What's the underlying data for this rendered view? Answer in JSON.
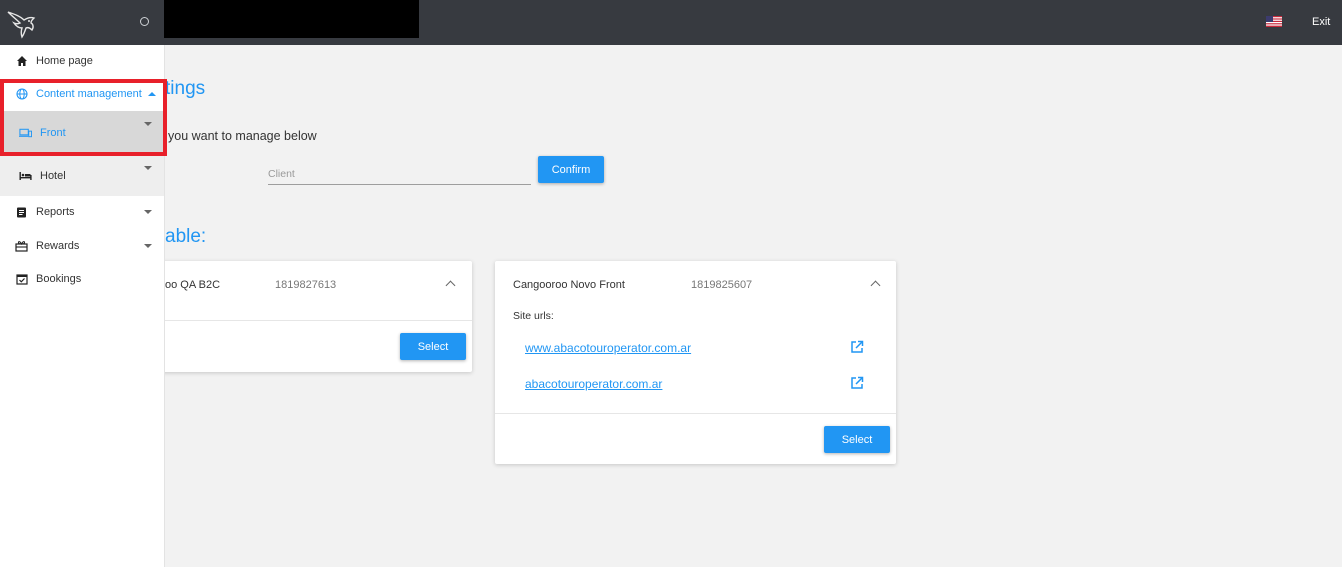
{
  "topbar": {
    "exit_label": "Exit",
    "bg_color": "#373a40",
    "flag_icon": "us-flag-icon"
  },
  "sidebar": {
    "items": [
      {
        "label": "Home page",
        "icon": "home-icon"
      },
      {
        "label": "Content management",
        "icon": "globe-icon",
        "expanded": true
      },
      {
        "label": "Front",
        "icon": "devices-icon"
      },
      {
        "label": "Hotel",
        "icon": "bed-icon"
      },
      {
        "label": "Reports",
        "icon": "clipboard-icon"
      },
      {
        "label": "Rewards",
        "icon": "gift-icon"
      },
      {
        "label": "Bookings",
        "icon": "calendar-check-icon"
      }
    ]
  },
  "main": {
    "page_title": "tings",
    "instruction": "you want to manage below",
    "client_placeholder": "Client",
    "confirm_label": "Confirm",
    "section_title": "able:"
  },
  "cards": [
    {
      "name": "oo QA B2C",
      "code": "1819827613",
      "select_label": "Select"
    },
    {
      "name": "Cangooroo Novo Front",
      "code": "1819825607",
      "site_urls_label": "Site urls:",
      "urls": [
        "www.abacotouroperator.com.ar",
        "abacotouroperator.com.ar"
      ],
      "select_label": "Select"
    }
  ],
  "colors": {
    "accent": "#2196f3",
    "highlight": "#e8202a"
  }
}
